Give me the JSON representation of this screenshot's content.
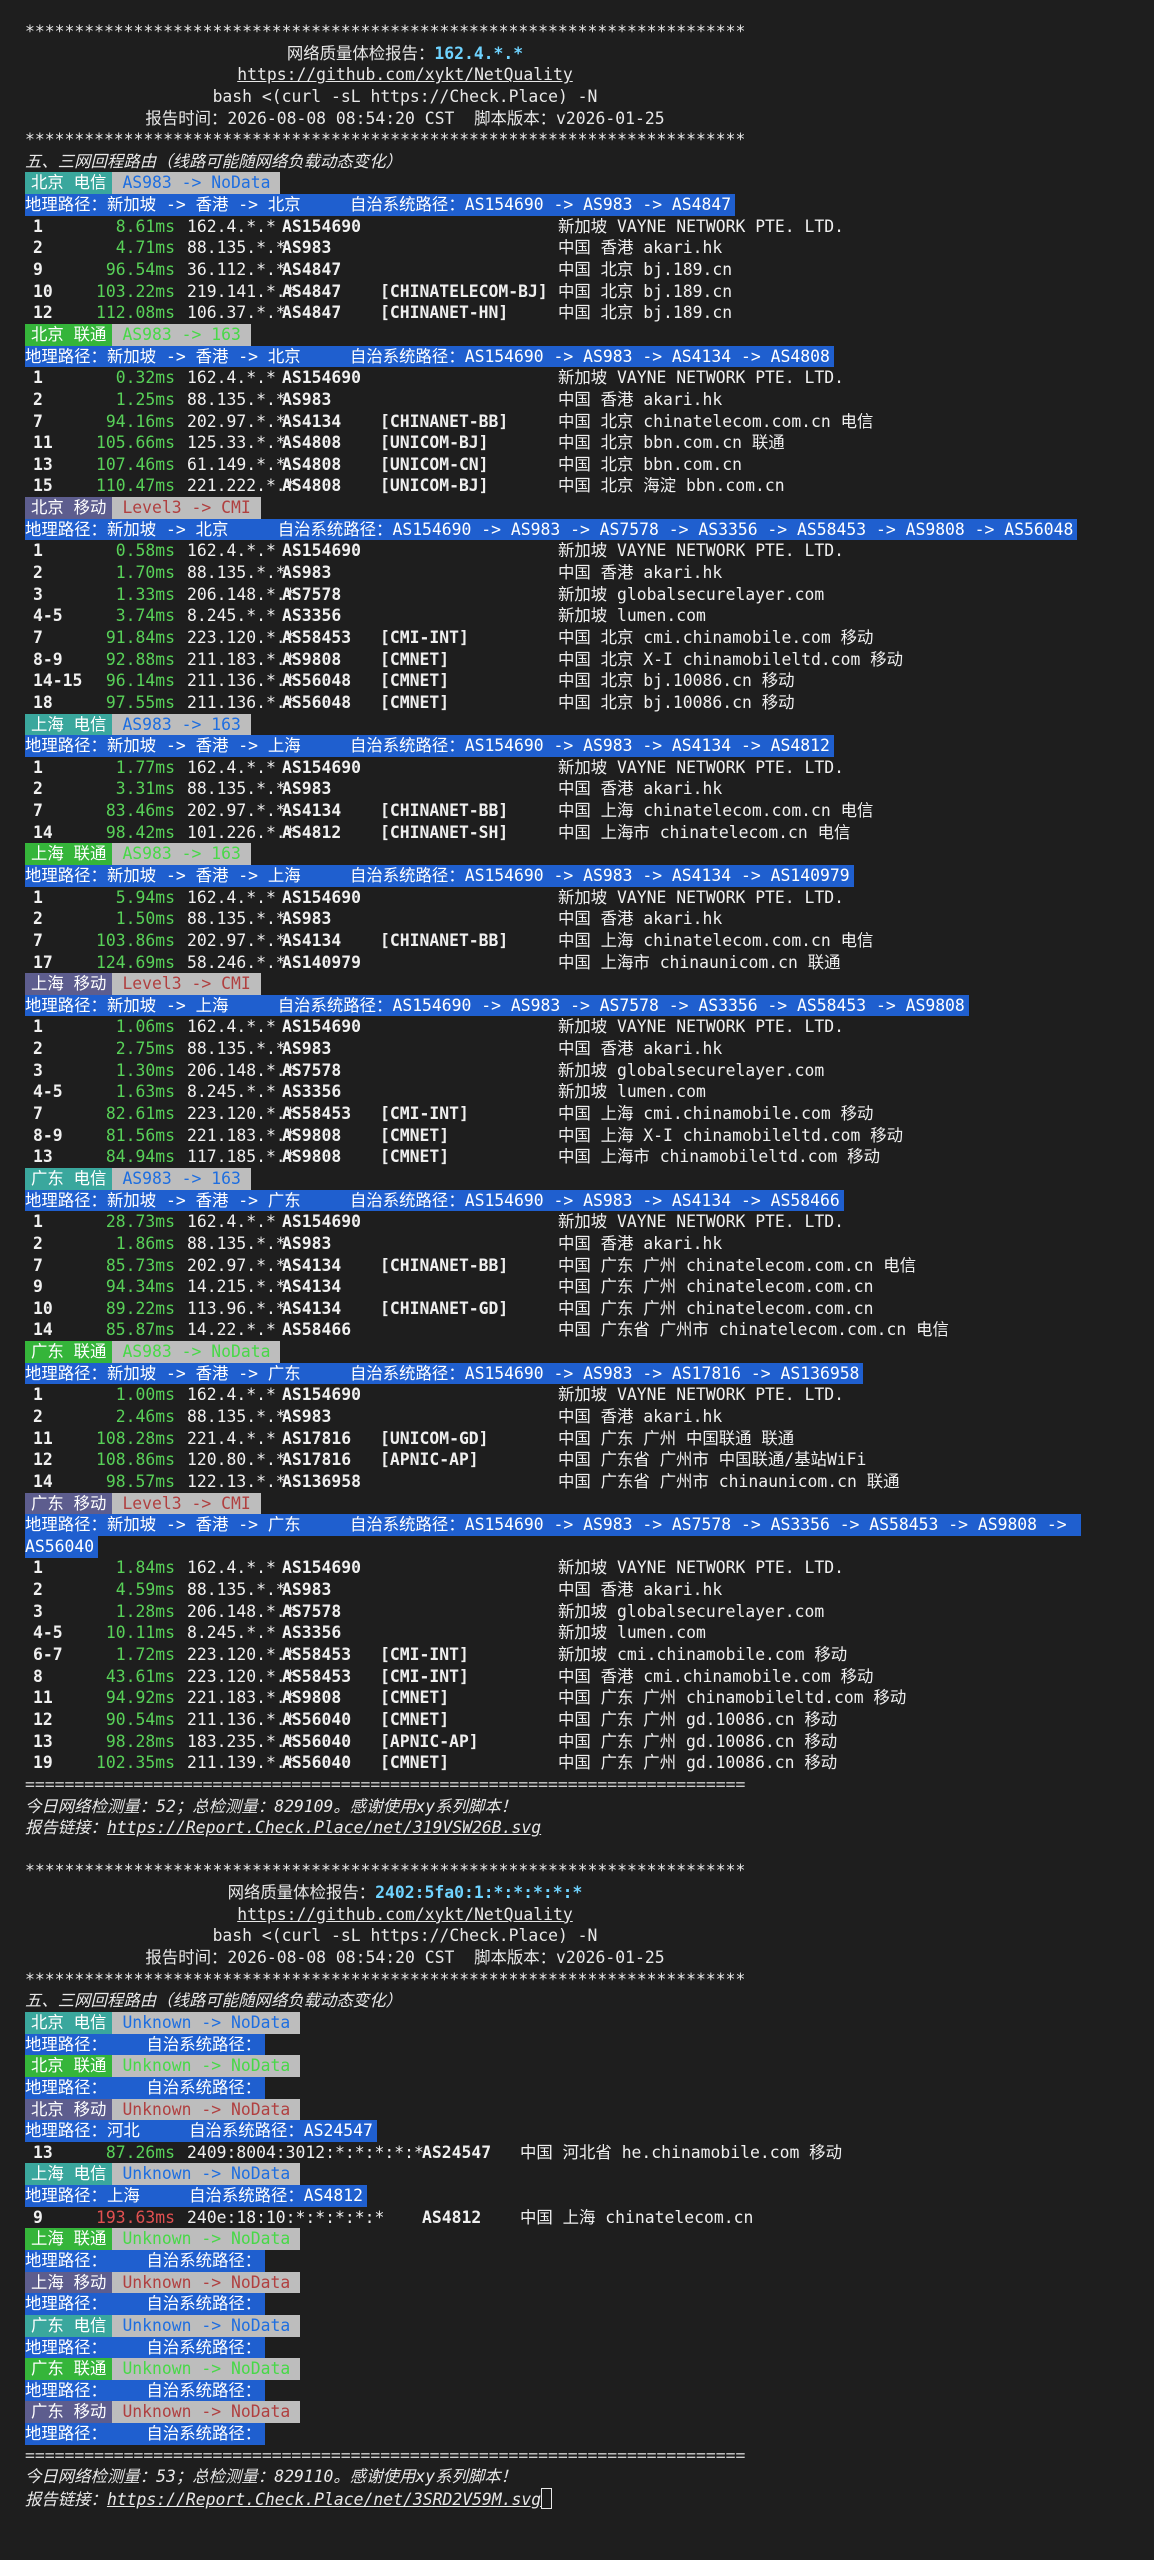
{
  "colors": {
    "background": "#1e1e1e",
    "geo_bar": "#1f5fcf",
    "ct_tag": "#3aa79d",
    "cu_tag": "#35b53a",
    "cm_tag": "#5d5d8e",
    "route_tag_bg": "#bdbdbd",
    "latency_ok": "#58d158",
    "latency_slow": "#e05050",
    "ip_highlight": "#6fd3ff"
  },
  "stars": "*************************************************************************",
  "equals": "=========================================================================",
  "reports": [
    {
      "title_prefix": "网络质量体检报告：",
      "title_ip": "162.4.*.*",
      "repo_url": "https://github.com/xykt/NetQuality",
      "command": "bash <(curl -sL https://Check.Place) -N",
      "time_line": "报告时间：2026-08-08 08:54:20 CST  脚本版本：v2026-01-25",
      "section_title": "五、三网回程路由（线路可能随网络负载动态变化）",
      "routes": [
        {
          "isp": "北京 电信",
          "isp_type": "ct",
          "route_tag": "AS983 -> NoData",
          "geo": "地理路径：新加坡 -> 香港 -> 北京     自治系统路径：AS154690 -> AS983 -> AS4847",
          "hops": [
            {
              "no": "1",
              "lat": "8.61ms",
              "ip": "162.4.*.*",
              "as": "AS154690",
              "net": "",
              "loc": "新加坡 VAYNE NETWORK PTE. LTD."
            },
            {
              "no": "2",
              "lat": "4.71ms",
              "ip": "88.135.*.*",
              "as": "AS983",
              "net": "",
              "loc": "中国 香港 akari.hk"
            },
            {
              "no": "9",
              "lat": "96.54ms",
              "ip": "36.112.*.*",
              "as": "AS4847",
              "net": "",
              "loc": "中国 北京 bj.189.cn"
            },
            {
              "no": "10",
              "lat": "103.22ms",
              "ip": "219.141.*.*",
              "as": "AS4847",
              "net": "[CHINATELECOM-BJ]",
              "loc": "中国 北京 bj.189.cn"
            },
            {
              "no": "12",
              "lat": "112.08ms",
              "ip": "106.37.*.*",
              "as": "AS4847",
              "net": "[CHINANET-HN]",
              "loc": "中国 北京 bj.189.cn"
            }
          ]
        },
        {
          "isp": "北京 联通",
          "isp_type": "cu",
          "route_tag": "AS983 -> 163",
          "geo": "地理路径：新加坡 -> 香港 -> 北京     自治系统路径：AS154690 -> AS983 -> AS4134 -> AS4808",
          "hops": [
            {
              "no": "1",
              "lat": "0.32ms",
              "ip": "162.4.*.*",
              "as": "AS154690",
              "net": "",
              "loc": "新加坡 VAYNE NETWORK PTE. LTD."
            },
            {
              "no": "2",
              "lat": "1.25ms",
              "ip": "88.135.*.*",
              "as": "AS983",
              "net": "",
              "loc": "中国 香港 akari.hk"
            },
            {
              "no": "7",
              "lat": "94.16ms",
              "ip": "202.97.*.*",
              "as": "AS4134",
              "net": "[CHINANET-BB]",
              "loc": "中国 北京 chinatelecom.com.cn 电信"
            },
            {
              "no": "11",
              "lat": "105.66ms",
              "ip": "125.33.*.*",
              "as": "AS4808",
              "net": "[UNICOM-BJ]",
              "loc": "中国 北京 bbn.com.cn 联通"
            },
            {
              "no": "13",
              "lat": "107.46ms",
              "ip": "61.149.*.*",
              "as": "AS4808",
              "net": "[UNICOM-CN]",
              "loc": "中国 北京 bbn.com.cn"
            },
            {
              "no": "15",
              "lat": "110.47ms",
              "ip": "221.222.*.*",
              "as": "AS4808",
              "net": "[UNICOM-BJ]",
              "loc": "中国 北京 海淀 bbn.com.cn"
            }
          ]
        },
        {
          "isp": "北京 移动",
          "isp_type": "cm",
          "route_tag": "Level3 -> CMI",
          "geo": "地理路径：新加坡 -> 北京     自治系统路径：AS154690 -> AS983 -> AS7578 -> AS3356 -> AS58453 -> AS9808 -> AS56048",
          "hops": [
            {
              "no": "1",
              "lat": "0.58ms",
              "ip": "162.4.*.*",
              "as": "AS154690",
              "net": "",
              "loc": "新加坡 VAYNE NETWORK PTE. LTD."
            },
            {
              "no": "2",
              "lat": "1.70ms",
              "ip": "88.135.*.*",
              "as": "AS983",
              "net": "",
              "loc": "中国 香港 akari.hk"
            },
            {
              "no": "3",
              "lat": "1.33ms",
              "ip": "206.148.*.*",
              "as": "AS7578",
              "net": "",
              "loc": "新加坡 globalsecurelayer.com"
            },
            {
              "no": "4-5",
              "lat": "3.74ms",
              "ip": "8.245.*.*",
              "as": "AS3356",
              "net": "",
              "loc": "新加坡 lumen.com"
            },
            {
              "no": "7",
              "lat": "91.84ms",
              "ip": "223.120.*.*",
              "as": "AS58453",
              "net": "[CMI-INT]",
              "loc": "中国 北京 cmi.chinamobile.com 移动"
            },
            {
              "no": "8-9",
              "lat": "92.88ms",
              "ip": "211.183.*.*",
              "as": "AS9808",
              "net": "[CMNET]",
              "loc": "中国 北京 X-I chinamobileltd.com 移动"
            },
            {
              "no": "14-15",
              "lat": "96.14ms",
              "ip": "211.136.*.*",
              "as": "AS56048",
              "net": "[CMNET]",
              "loc": "中国 北京 bj.10086.cn 移动"
            },
            {
              "no": "18",
              "lat": "97.55ms",
              "ip": "211.136.*.*",
              "as": "AS56048",
              "net": "[CMNET]",
              "loc": "中国 北京 bj.10086.cn 移动"
            }
          ]
        },
        {
          "isp": "上海 电信",
          "isp_type": "ct",
          "route_tag": "AS983 -> 163",
          "geo": "地理路径：新加坡 -> 香港 -> 上海     自治系统路径：AS154690 -> AS983 -> AS4134 -> AS4812",
          "hops": [
            {
              "no": "1",
              "lat": "1.77ms",
              "ip": "162.4.*.*",
              "as": "AS154690",
              "net": "",
              "loc": "新加坡 VAYNE NETWORK PTE. LTD."
            },
            {
              "no": "2",
              "lat": "3.31ms",
              "ip": "88.135.*.*",
              "as": "AS983",
              "net": "",
              "loc": "中国 香港 akari.hk"
            },
            {
              "no": "7",
              "lat": "83.46ms",
              "ip": "202.97.*.*",
              "as": "AS4134",
              "net": "[CHINANET-BB]",
              "loc": "中国 上海 chinatelecom.com.cn 电信"
            },
            {
              "no": "14",
              "lat": "98.42ms",
              "ip": "101.226.*.*",
              "as": "AS4812",
              "net": "[CHINANET-SH]",
              "loc": "中国 上海市 chinatelecom.cn 电信"
            }
          ]
        },
        {
          "isp": "上海 联通",
          "isp_type": "cu",
          "route_tag": "AS983 -> 163",
          "geo": "地理路径：新加坡 -> 香港 -> 上海     自治系统路径：AS154690 -> AS983 -> AS4134 -> AS140979",
          "hops": [
            {
              "no": "1",
              "lat": "5.94ms",
              "ip": "162.4.*.*",
              "as": "AS154690",
              "net": "",
              "loc": "新加坡 VAYNE NETWORK PTE. LTD."
            },
            {
              "no": "2",
              "lat": "1.50ms",
              "ip": "88.135.*.*",
              "as": "AS983",
              "net": "",
              "loc": "中国 香港 akari.hk"
            },
            {
              "no": "7",
              "lat": "103.86ms",
              "ip": "202.97.*.*",
              "as": "AS4134",
              "net": "[CHINANET-BB]",
              "loc": "中国 上海 chinatelecom.com.cn 电信"
            },
            {
              "no": "17",
              "lat": "124.69ms",
              "ip": "58.246.*.*",
              "as": "AS140979",
              "net": "",
              "loc": "中国 上海市 chinaunicom.cn 联通"
            }
          ]
        },
        {
          "isp": "上海 移动",
          "isp_type": "cm",
          "route_tag": "Level3 -> CMI",
          "geo": "地理路径：新加坡 -> 上海     自治系统路径：AS154690 -> AS983 -> AS7578 -> AS3356 -> AS58453 -> AS9808",
          "hops": [
            {
              "no": "1",
              "lat": "1.06ms",
              "ip": "162.4.*.*",
              "as": "AS154690",
              "net": "",
              "loc": "新加坡 VAYNE NETWORK PTE. LTD."
            },
            {
              "no": "2",
              "lat": "2.75ms",
              "ip": "88.135.*.*",
              "as": "AS983",
              "net": "",
              "loc": "中国 香港 akari.hk"
            },
            {
              "no": "3",
              "lat": "1.30ms",
              "ip": "206.148.*.*",
              "as": "AS7578",
              "net": "",
              "loc": "新加坡 globalsecurelayer.com"
            },
            {
              "no": "4-5",
              "lat": "1.63ms",
              "ip": "8.245.*.*",
              "as": "AS3356",
              "net": "",
              "loc": "新加坡 lumen.com"
            },
            {
              "no": "7",
              "lat": "82.61ms",
              "ip": "223.120.*.*",
              "as": "AS58453",
              "net": "[CMI-INT]",
              "loc": "中国 上海 cmi.chinamobile.com 移动"
            },
            {
              "no": "8-9",
              "lat": "81.56ms",
              "ip": "221.183.*.*",
              "as": "AS9808",
              "net": "[CMNET]",
              "loc": "中国 上海 X-I chinamobileltd.com 移动"
            },
            {
              "no": "13",
              "lat": "84.94ms",
              "ip": "117.185.*.*",
              "as": "AS9808",
              "net": "[CMNET]",
              "loc": "中国 上海市 chinamobileltd.com 移动"
            }
          ]
        },
        {
          "isp": "广东 电信",
          "isp_type": "ct",
          "route_tag": "AS983 -> 163",
          "geo": "地理路径：新加坡 -> 香港 -> 广东     自治系统路径：AS154690 -> AS983 -> AS4134 -> AS58466",
          "hops": [
            {
              "no": "1",
              "lat": "28.73ms",
              "ip": "162.4.*.*",
              "as": "AS154690",
              "net": "",
              "loc": "新加坡 VAYNE NETWORK PTE. LTD."
            },
            {
              "no": "2",
              "lat": "1.86ms",
              "ip": "88.135.*.*",
              "as": "AS983",
              "net": "",
              "loc": "中国 香港 akari.hk"
            },
            {
              "no": "7",
              "lat": "85.73ms",
              "ip": "202.97.*.*",
              "as": "AS4134",
              "net": "[CHINANET-BB]",
              "loc": "中国 广东 广州 chinatelecom.com.cn 电信"
            },
            {
              "no": "9",
              "lat": "94.34ms",
              "ip": "14.215.*.*",
              "as": "AS4134",
              "net": "",
              "loc": "中国 广东 广州 chinatelecom.com.cn"
            },
            {
              "no": "10",
              "lat": "89.22ms",
              "ip": "113.96.*.*",
              "as": "AS4134",
              "net": "[CHINANET-GD]",
              "loc": "中国 广东 广州 chinatelecom.com.cn"
            },
            {
              "no": "14",
              "lat": "85.87ms",
              "ip": "14.22.*.*",
              "as": "AS58466",
              "net": "",
              "loc": "中国 广东省 广州市 chinatelecom.com.cn 电信"
            }
          ]
        },
        {
          "isp": "广东 联通",
          "isp_type": "cu",
          "route_tag": "AS983 -> NoData",
          "geo": "地理路径：新加坡 -> 香港 -> 广东     自治系统路径：AS154690 -> AS983 -> AS17816 -> AS136958",
          "hops": [
            {
              "no": "1",
              "lat": "1.00ms",
              "ip": "162.4.*.*",
              "as": "AS154690",
              "net": "",
              "loc": "新加坡 VAYNE NETWORK PTE. LTD."
            },
            {
              "no": "2",
              "lat": "2.46ms",
              "ip": "88.135.*.*",
              "as": "AS983",
              "net": "",
              "loc": "中国 香港 akari.hk"
            },
            {
              "no": "11",
              "lat": "108.28ms",
              "ip": "221.4.*.*",
              "as": "AS17816",
              "net": "[UNICOM-GD]",
              "loc": "中国 广东 广州 中国联通 联通"
            },
            {
              "no": "12",
              "lat": "108.86ms",
              "ip": "120.80.*.*",
              "as": "AS17816",
              "net": "[APNIC-AP]",
              "loc": "中国 广东省 广州市 中国联通/基站WiFi"
            },
            {
              "no": "14",
              "lat": "98.57ms",
              "ip": "122.13.*.*",
              "as": "AS136958",
              "net": "",
              "loc": "中国 广东省 广州市 chinaunicom.cn 联通"
            }
          ]
        },
        {
          "isp": "广东 移动",
          "isp_type": "cm",
          "route_tag": "Level3 -> CMI",
          "geo": "地理路径：新加坡 -> 香港 -> 广东     自治系统路径：AS154690 -> AS983 -> AS7578 -> AS3356 -> AS58453 -> AS9808 -> AS56040",
          "geo_wraps": true,
          "hops": [
            {
              "no": "1",
              "lat": "1.84ms",
              "ip": "162.4.*.*",
              "as": "AS154690",
              "net": "",
              "loc": "新加坡 VAYNE NETWORK PTE. LTD."
            },
            {
              "no": "2",
              "lat": "4.59ms",
              "ip": "88.135.*.*",
              "as": "AS983",
              "net": "",
              "loc": "中国 香港 akari.hk"
            },
            {
              "no": "3",
              "lat": "1.28ms",
              "ip": "206.148.*.*",
              "as": "AS7578",
              "net": "",
              "loc": "新加坡 globalsecurelayer.com"
            },
            {
              "no": "4-5",
              "lat": "10.11ms",
              "ip": "8.245.*.*",
              "as": "AS3356",
              "net": "",
              "loc": "新加坡 lumen.com"
            },
            {
              "no": "6-7",
              "lat": "1.72ms",
              "ip": "223.120.*.*",
              "as": "AS58453",
              "net": "[CMI-INT]",
              "loc": "新加坡 cmi.chinamobile.com 移动"
            },
            {
              "no": "8",
              "lat": "43.61ms",
              "ip": "223.120.*.*",
              "as": "AS58453",
              "net": "[CMI-INT]",
              "loc": "中国 香港 cmi.chinamobile.com 移动"
            },
            {
              "no": "11",
              "lat": "94.92ms",
              "ip": "221.183.*.*",
              "as": "AS9808",
              "net": "[CMNET]",
              "loc": "中国 广东 广州 chinamobileltd.com 移动"
            },
            {
              "no": "12",
              "lat": "90.54ms",
              "ip": "211.136.*.*",
              "as": "AS56040",
              "net": "[CMNET]",
              "loc": "中国 广东 广州 gd.10086.cn 移动"
            },
            {
              "no": "13",
              "lat": "98.28ms",
              "ip": "183.235.*.*",
              "as": "AS56040",
              "net": "[APNIC-AP]",
              "loc": "中国 广东 广州 gd.10086.cn 移动"
            },
            {
              "no": "19",
              "lat": "102.35ms",
              "ip": "211.139.*.*",
              "as": "AS56040",
              "net": "[CMNET]",
              "loc": "中国 广东 广州 gd.10086.cn 移动"
            }
          ]
        }
      ],
      "footer_stats": "今日网络检测量：52；总检测量：829109。感谢使用xy系列脚本！",
      "footer_link_label": "报告链接：",
      "footer_link": "https://Report.Check.Place/net/319VSW26B.svg"
    },
    {
      "title_prefix": "网络质量体检报告：",
      "title_ip": "2402:5fa0:1:*:*:*:*:*",
      "repo_url": "https://github.com/xykt/NetQuality",
      "command": "bash <(curl -sL https://Check.Place) -N",
      "time_line": "报告时间：2026-08-08 08:54:20 CST  脚本版本：v2026-01-25",
      "section_title": "五、三网回程路由（线路可能随网络负载动态变化）",
      "routes": [
        {
          "isp": "北京 电信",
          "isp_type": "ct",
          "route_tag": "Unknown -> NoData",
          "geo": "地理路径：    自治系统路径：",
          "hops": []
        },
        {
          "isp": "北京 联通",
          "isp_type": "cu",
          "route_tag": "Unknown -> NoData",
          "geo": "地理路径：    自治系统路径：",
          "hops": []
        },
        {
          "isp": "北京 移动",
          "isp_type": "cm",
          "route_tag": "Unknown -> NoData",
          "geo": "地理路径：河北     自治系统路径：AS24547",
          "hops": [
            {
              "no": "13",
              "lat": "87.26ms",
              "ip6": "2409:8004:3012:*:*:*:*:*",
              "as": "AS24547",
              "loc": "中国 河北省 he.chinamobile.com 移动",
              "slow": false
            }
          ]
        },
        {
          "isp": "上海 电信",
          "isp_type": "ct",
          "route_tag": "Unknown -> NoData",
          "geo": "地理路径：上海     自治系统路径：AS4812",
          "hops": [
            {
              "no": "9",
              "lat": "193.63ms",
              "ip6": "240e:18:10:*:*:*:*:*",
              "as": "AS4812",
              "loc": "中国 上海 chinatelecom.cn",
              "slow": true
            }
          ]
        },
        {
          "isp": "上海 联通",
          "isp_type": "cu",
          "route_tag": "Unknown -> NoData",
          "geo": "地理路径：    自治系统路径：",
          "hops": []
        },
        {
          "isp": "上海 移动",
          "isp_type": "cm",
          "route_tag": "Unknown -> NoData",
          "geo": "地理路径：    自治系统路径：",
          "hops": []
        },
        {
          "isp": "广东 电信",
          "isp_type": "ct",
          "route_tag": "Unknown -> NoData",
          "geo": "地理路径：    自治系统路径：",
          "hops": []
        },
        {
          "isp": "广东 联通",
          "isp_type": "cu",
          "route_tag": "Unknown -> NoData",
          "geo": "地理路径：    自治系统路径：",
          "hops": []
        },
        {
          "isp": "广东 移动",
          "isp_type": "cm",
          "route_tag": "Unknown -> NoData",
          "geo": "地理路径：    自治系统路径：",
          "hops": []
        }
      ],
      "footer_stats": "今日网络检测量：53；总检测量：829110。感谢使用xy系列脚本！",
      "footer_link_label": "报告链接：",
      "footer_link": "https://Report.Check.Place/net/3SRD2V59M.svg"
    }
  ]
}
